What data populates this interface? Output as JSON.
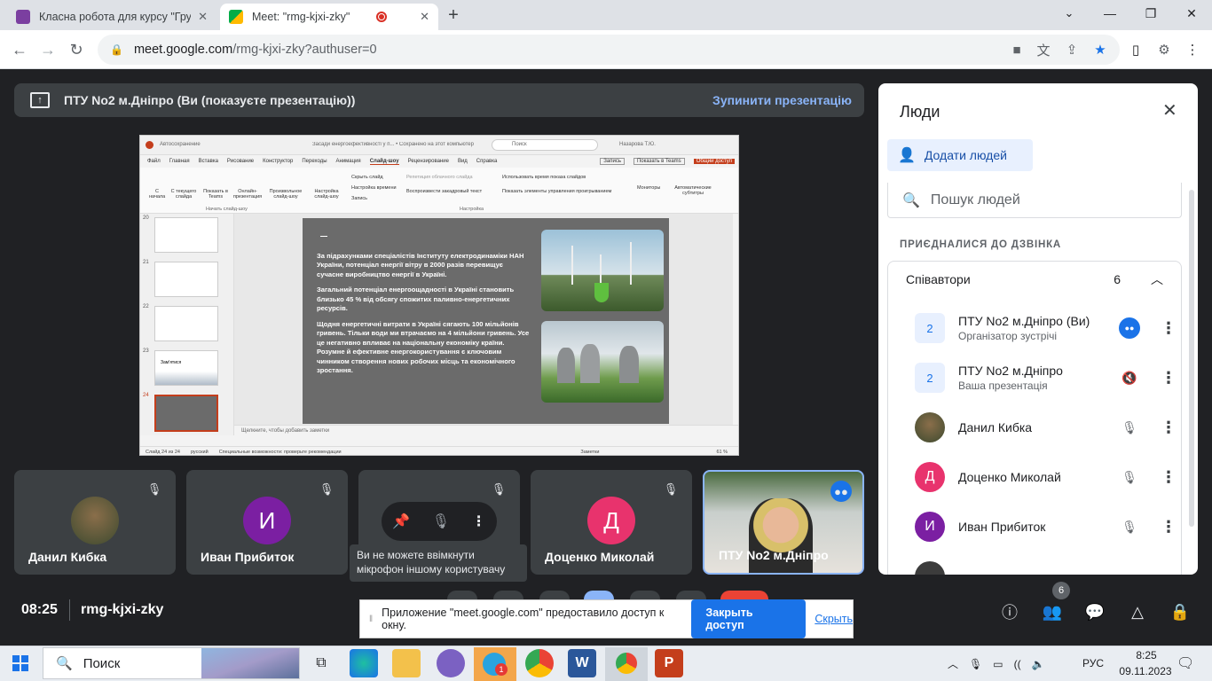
{
  "tabs": [
    {
      "label": "Класна робота для курсу \"Груп",
      "close": "✕"
    },
    {
      "label": "Meet: \"rmg-kjxi-zky\"",
      "close": "✕"
    }
  ],
  "new_tab": "+",
  "window_controls": {
    "minimize": "—",
    "maximize": "❐",
    "close": "✕",
    "menu": "⌄"
  },
  "address": {
    "host": "meet.google.com",
    "path": "/rmg-kjxi-zky?authuser=0"
  },
  "banner": {
    "title": "ПТУ No2 м.Дніпро (Ви (показуєте презентацію))",
    "stop": "Зупинити презентацію"
  },
  "ppt": {
    "autosave": "Автосохранение",
    "doc_title": "Засади енергоефективності у п... • Сохранено на этот компьютер",
    "search": "Поиск",
    "user": "Назарова Т.Ю.",
    "ribbon_tabs": [
      "Файл",
      "Главная",
      "Вставка",
      "Рисование",
      "Конструктор",
      "Переходы",
      "Анимация",
      "Слайд-шоу",
      "Рецензирование",
      "Вид",
      "Справка"
    ],
    "ribbon_buttons": [
      "С начала",
      "С текущего слайда",
      "Показать в Teams",
      "Онлайн-презентация",
      "Произвольное слайд-шоу",
      "Настройка слайд-шоу",
      "Скрыть слайд",
      "Настройка времени",
      "Запись",
      "Мониторы",
      "Автоматические субтитры"
    ],
    "ribbon_checks": [
      "Воспроизвести закадровый текст",
      "Использовать время показа слайдов",
      "Показать элементы управления проигрыванием",
      "Репетиция облачного слайда"
    ],
    "ribbon_groups": [
      "Начать слайд-шоу",
      "Настройка"
    ],
    "comment_btn": "Запись",
    "teams_btn": "Показать в Teams",
    "share_btn": "Общий доступ",
    "thumb_numbers": [
      "20",
      "21",
      "22",
      "23",
      "24"
    ],
    "thumb_23_text": "Зам'ятися",
    "slide_text": [
      "За підрахунками спеціалістів Інституту електродинаміки НАН України, потенціал енергії вітру в 2000 разів перевищує сучасне виробництво енергії в Україні.",
      "Загальний потенціал енергоощадності в Україні становить близько 45 % від обсягу спожитих паливно-енергетичних ресурсів.",
      "Щодня енергетичні витрати в Україні сягають 100 мільйонів гривень. Тільки води ми втрачаємо на 4 мільйони гривень. Усе це негативно впливає на національну економіку країни. Розумне й ефективне енергокористування є ключовим чинником створення нових робочих місць та економічного зростання."
    ],
    "notes": "Щелкните, чтобы добавить заметки",
    "status": {
      "slide": "Слайд 24 из 24",
      "lang": "русский",
      "access": "Специальные возможности: проверьте рекомендации",
      "notes": "Заметки",
      "zoom": "61 %"
    }
  },
  "tiles": [
    {
      "name": "Данил Кибка",
      "avatar": ""
    },
    {
      "name": "Иван Прибиток",
      "avatar": "И",
      "color": "#7b1fa2"
    },
    {
      "name": "",
      "avatar": ""
    },
    {
      "name": "Доценко Миколай",
      "avatar": "Д",
      "color": "#e8336d"
    },
    {
      "name": "ПТУ No2 м.Дніпро",
      "avatar": ""
    }
  ],
  "tooltip": "Ви не можете ввімкнути мікрофон іншому користувачу",
  "people": {
    "title": "Люди",
    "add": "Додати людей",
    "search": "Пошук людей",
    "section": "ПРИЄДНАЛИСЯ ДО ДЗВІНКА",
    "group": "Співавтори",
    "group_count": "6",
    "list": [
      {
        "name": "ПТУ No2 м.Дніпро (Ви)",
        "role": "Організатор зустрічі",
        "av": ""
      },
      {
        "name": "ПТУ No2 м.Дніпро",
        "role": "Ваша презентація",
        "av": ""
      },
      {
        "name": "Данил Кибка",
        "role": "",
        "av": ""
      },
      {
        "name": "Доценко Миколай",
        "role": "",
        "av": "Д",
        "color": "#e8336d"
      },
      {
        "name": "Иван Прибиток",
        "role": "",
        "av": "И",
        "color": "#7b1fa2"
      }
    ]
  },
  "bottom": {
    "time": "08:25",
    "code": "rmg-kjxi-zky",
    "people_badge": "6"
  },
  "share_notice": {
    "text": "Приложение \"meet.google.com\" предоставило доступ к окну.",
    "close": "Закрыть доступ",
    "hide": "Скрыть"
  },
  "taskbar": {
    "search": "Поиск",
    "lang": "РУС",
    "time": "8:25",
    "date": "09.11.2023",
    "telegram_badge": "1"
  }
}
